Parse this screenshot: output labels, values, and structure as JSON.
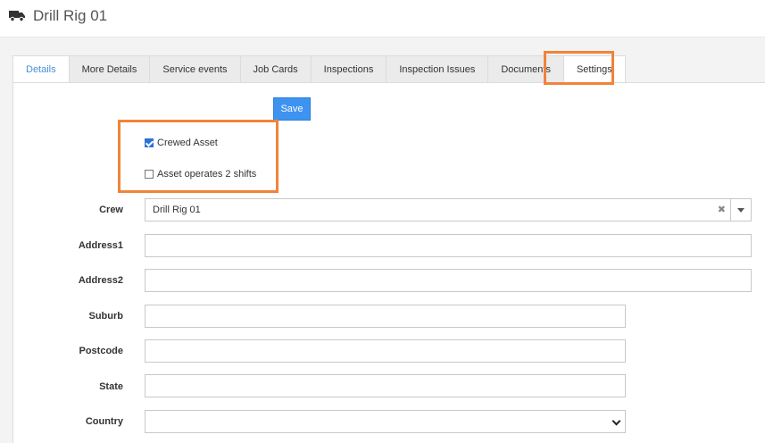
{
  "header": {
    "title": "Drill Rig 01",
    "icon": "truck-icon"
  },
  "tabs": [
    {
      "label": "Details"
    },
    {
      "label": "More Details"
    },
    {
      "label": "Service events"
    },
    {
      "label": "Job Cards"
    },
    {
      "label": "Inspections"
    },
    {
      "label": "Inspection Issues"
    },
    {
      "label": "Documents"
    },
    {
      "label": "Settings"
    }
  ],
  "actions": {
    "save_label": "Save"
  },
  "options": {
    "crewed_asset": {
      "label": "Crewed Asset",
      "checked": true
    },
    "two_shifts": {
      "label": "Asset operates 2 shifts",
      "checked": false
    }
  },
  "form": {
    "crew": {
      "label": "Crew",
      "value": "Drill Rig 01"
    },
    "address1": {
      "label": "Address1",
      "value": ""
    },
    "address2": {
      "label": "Address2",
      "value": ""
    },
    "suburb": {
      "label": "Suburb",
      "value": ""
    },
    "postcode": {
      "label": "Postcode",
      "value": ""
    },
    "state": {
      "label": "State",
      "value": ""
    },
    "country": {
      "label": "Country",
      "value": ""
    }
  },
  "colors": {
    "accent": "#3e93f0",
    "highlight": "#f0843a",
    "active_tab_text": "#4a8fd8"
  }
}
